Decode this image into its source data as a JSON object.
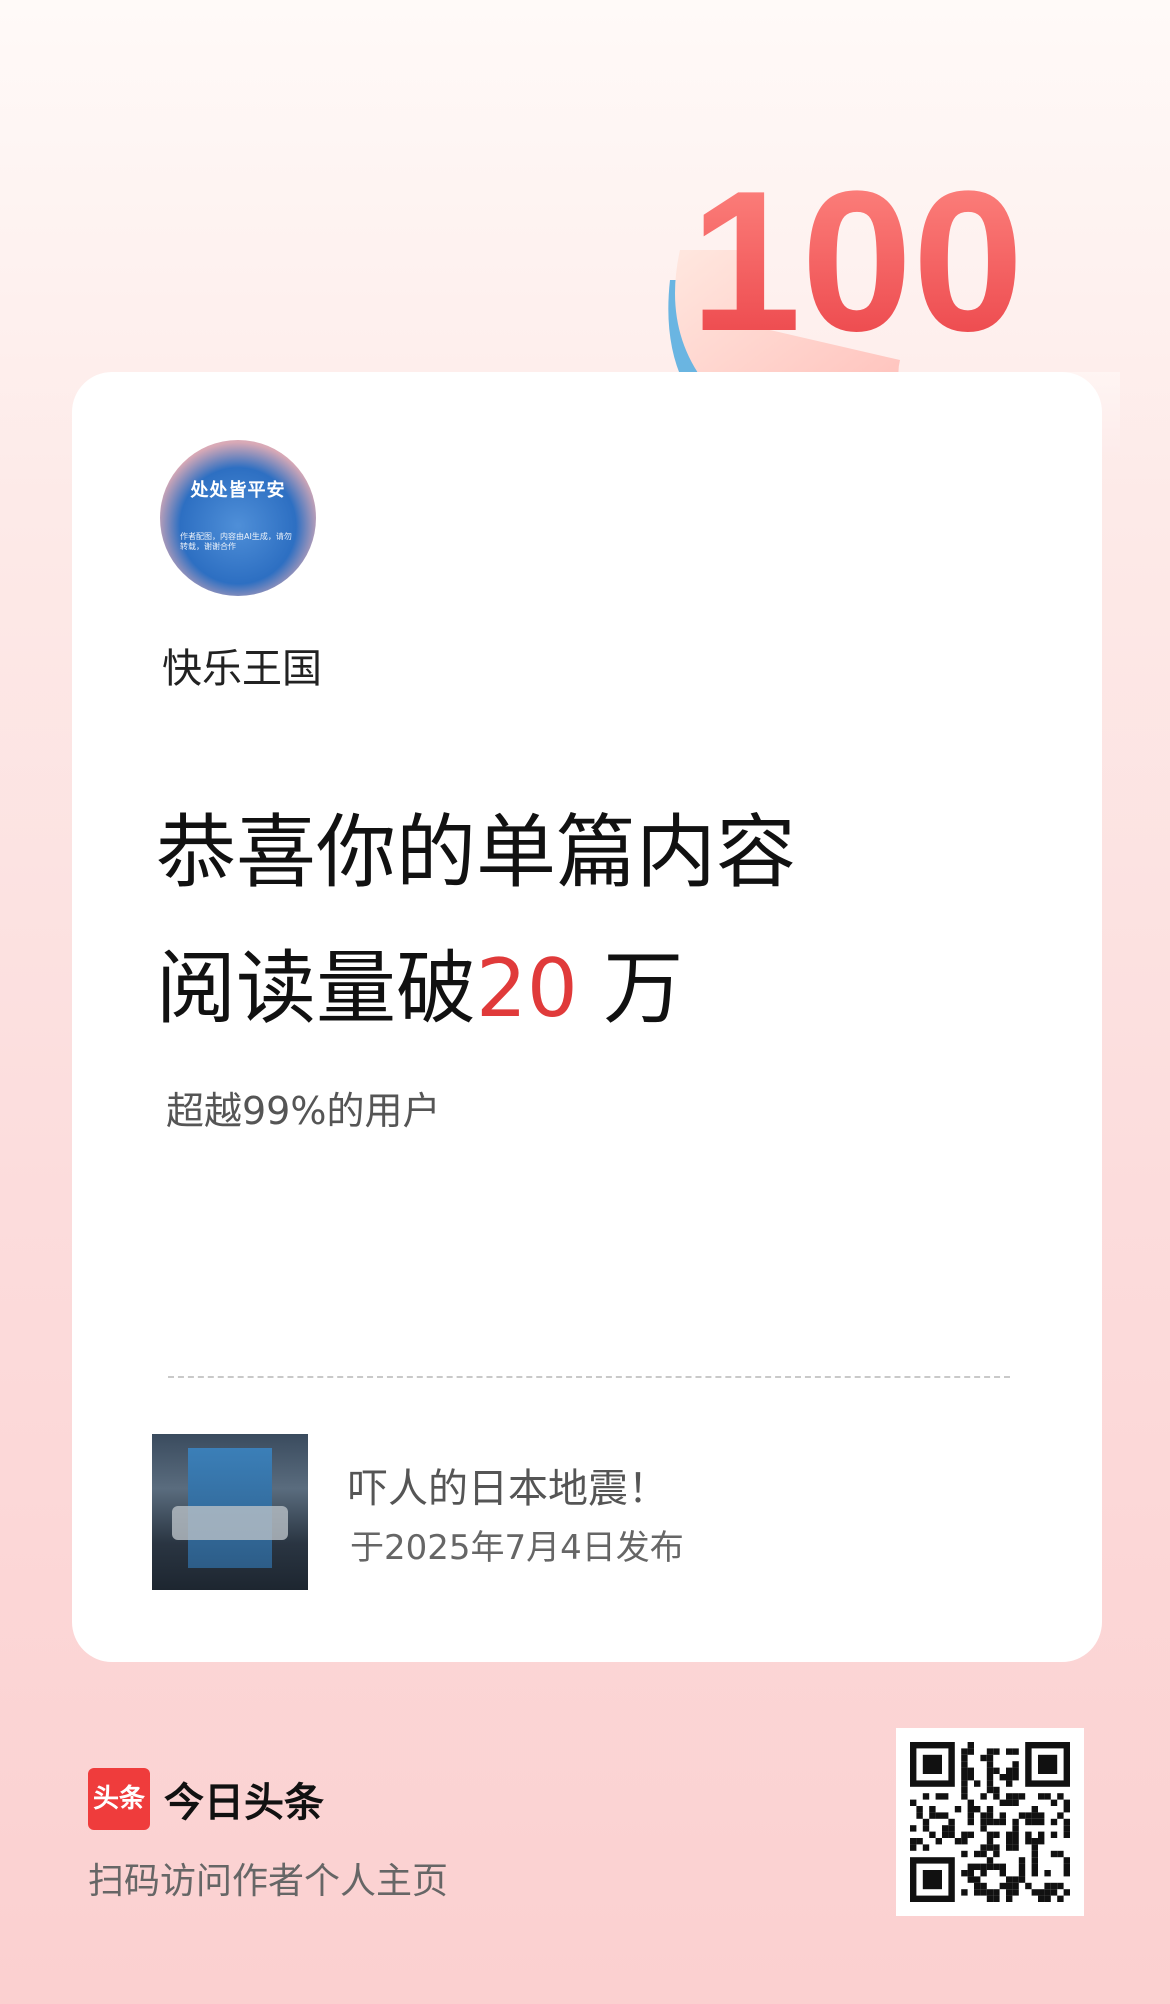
{
  "badge": {
    "number": "100"
  },
  "profile": {
    "avatar_title": "处处皆平安",
    "avatar_subtitle": "作者配图，内容由AI生成，请勿转载，谢谢合作",
    "username": "快乐王国"
  },
  "achievement": {
    "headline_line1": "恭喜你的单篇内容",
    "headline_line2_prefix": "阅读量破",
    "headline_number": "20",
    "headline_line2_suffix": "万",
    "subline": "超越99%的用户"
  },
  "article": {
    "title": "吓人的日本地震！",
    "published": "于2025年7月4日发布"
  },
  "footer": {
    "logo_text": "头条",
    "brand_name": "今日头条",
    "scan_text": "扫码访问作者个人主页"
  },
  "colors": {
    "accent": "#e03a3a",
    "logo": "#ef3c3c"
  }
}
